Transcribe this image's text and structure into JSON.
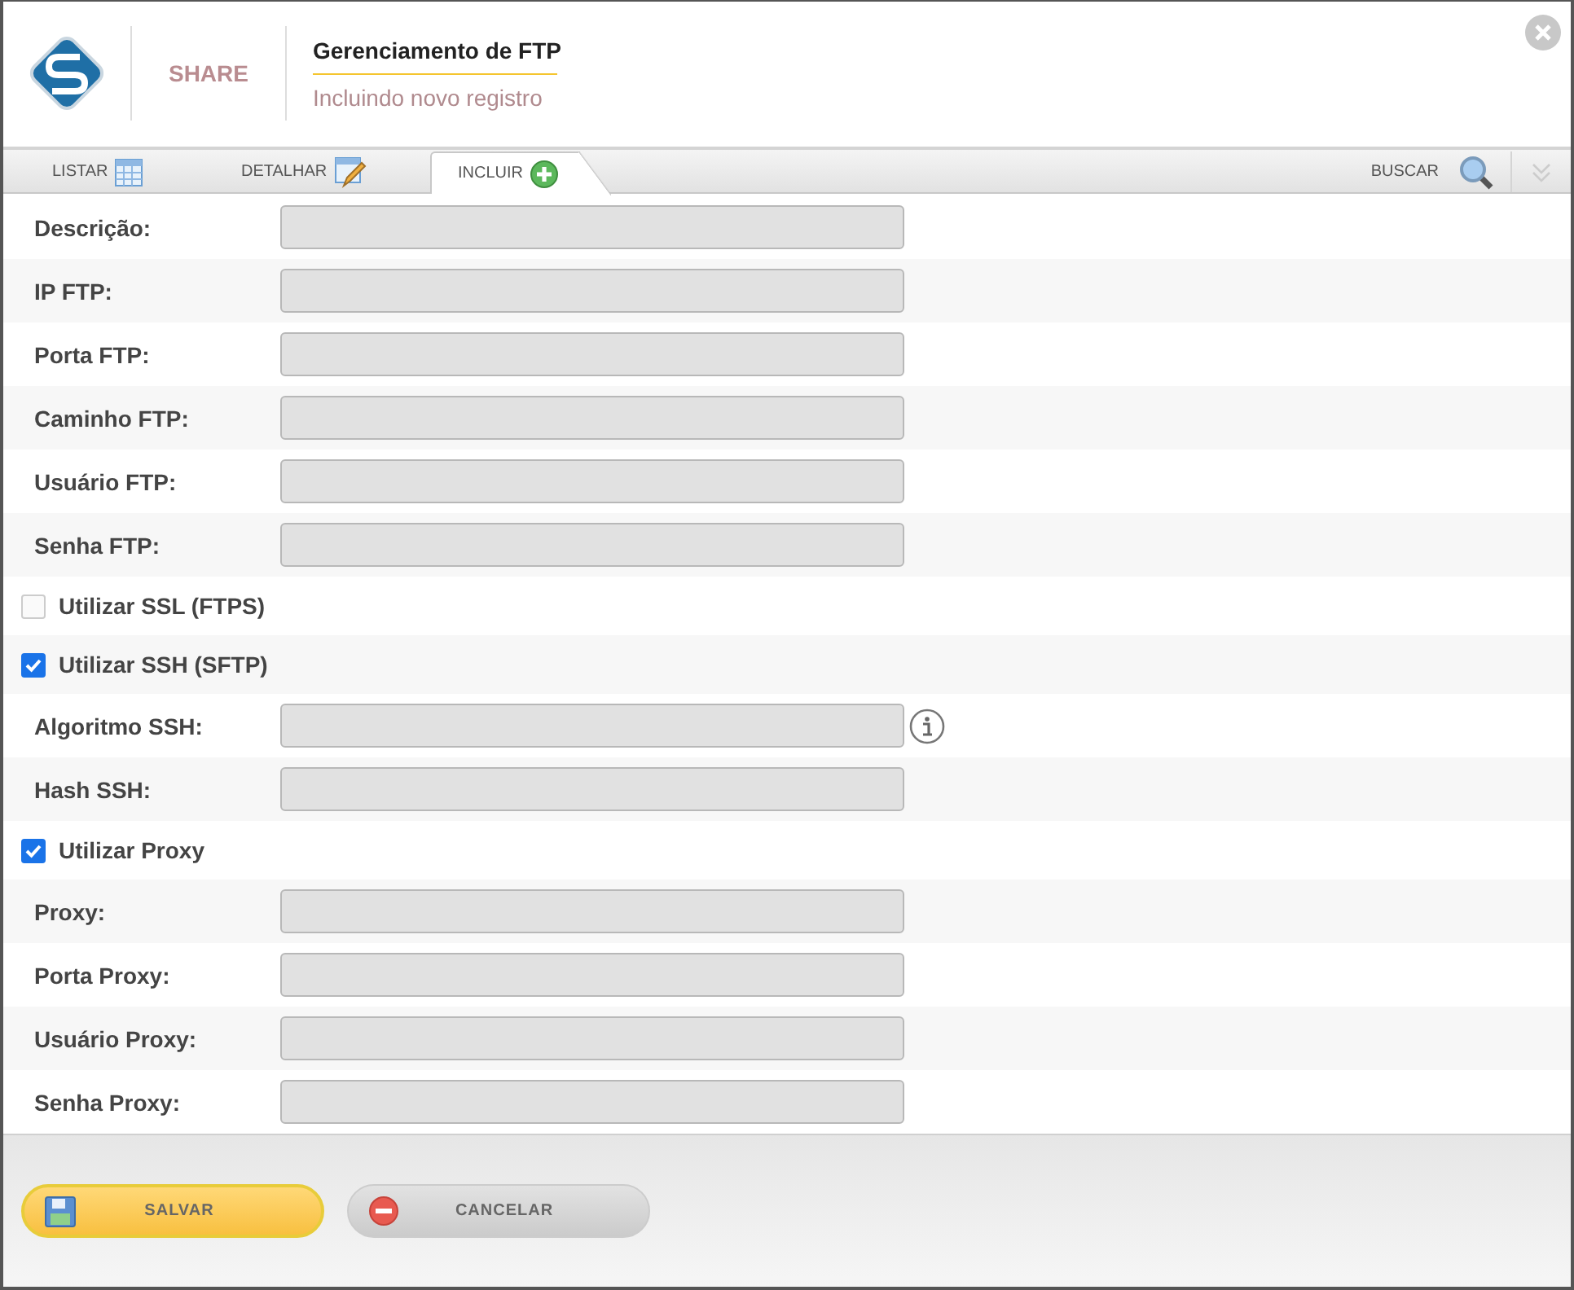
{
  "header": {
    "brand": "SHARE",
    "title": "Gerenciamento de FTP",
    "subtitle": "Incluindo novo registro"
  },
  "tabs": [
    {
      "label": "LISTAR",
      "kind": "table",
      "selected": false
    },
    {
      "label": "DETALHAR",
      "kind": "edit",
      "selected": false
    },
    {
      "label": "INCLUIR",
      "kind": "add",
      "selected": true
    }
  ],
  "search": {
    "label": "BUSCAR"
  },
  "form": [
    {
      "kind": "field",
      "label": "Descrição:"
    },
    {
      "kind": "field",
      "label": "IP FTP:"
    },
    {
      "kind": "field",
      "label": "Porta FTP:"
    },
    {
      "kind": "field",
      "label": "Caminho FTP:"
    },
    {
      "kind": "field",
      "label": "Usuário FTP:"
    },
    {
      "kind": "field",
      "label": "Senha FTP:"
    },
    {
      "kind": "checkbox",
      "label": "Utilizar SSL (FTPS)",
      "checked": false
    },
    {
      "kind": "checkbox",
      "label": "Utilizar SSH (SFTP)",
      "checked": true
    },
    {
      "kind": "field",
      "label": "Algoritmo SSH:",
      "info": true
    },
    {
      "kind": "field",
      "label": "Hash SSH:"
    },
    {
      "kind": "checkbox",
      "label": "Utilizar Proxy",
      "checked": true
    },
    {
      "kind": "field",
      "label": "Proxy:"
    },
    {
      "kind": "field",
      "label": "Porta Proxy:"
    },
    {
      "kind": "field",
      "label": "Usuário Proxy:"
    },
    {
      "kind": "field",
      "label": "Senha Proxy:"
    }
  ],
  "buttons": [
    {
      "kind": "save",
      "label": "SALVAR"
    },
    {
      "kind": "cancel",
      "label": "CANCELAR"
    }
  ]
}
